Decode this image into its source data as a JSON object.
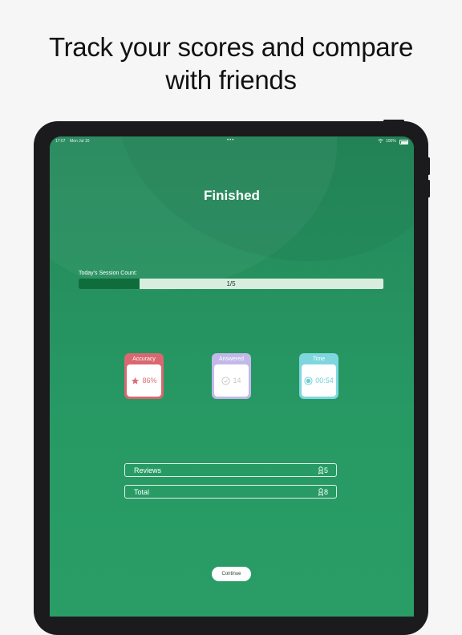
{
  "headline": {
    "line1": "Track your scores and compare",
    "line2": "with friends"
  },
  "status_bar": {
    "time": "17:07",
    "date": "Mon Jul 10",
    "dots": "•••",
    "battery": "100%"
  },
  "screen": {
    "title": "Finished",
    "session": {
      "label": "Today's Session Count:",
      "progress_text": "1/5",
      "progress_fraction": 0.2
    },
    "stats": {
      "accuracy": {
        "label": "Accuracy",
        "value": "86%",
        "icon": "star-icon",
        "color": "#d96870"
      },
      "answered": {
        "label": "Answered",
        "value": "14",
        "icon": "check-circle-icon",
        "color": "#c3b9e9"
      },
      "time": {
        "label": "Time",
        "value": "00:54",
        "icon": "clock-icon",
        "color": "#7fd6df"
      }
    },
    "rows": {
      "reviews": {
        "label": "Reviews",
        "value": "5",
        "icon": "award-icon"
      },
      "total": {
        "label": "Total",
        "value": "8",
        "icon": "award-icon"
      }
    },
    "continue_label": "Continue"
  },
  "colors": {
    "background_green": "#279a64",
    "progress_fill": "#0f6d3c"
  }
}
